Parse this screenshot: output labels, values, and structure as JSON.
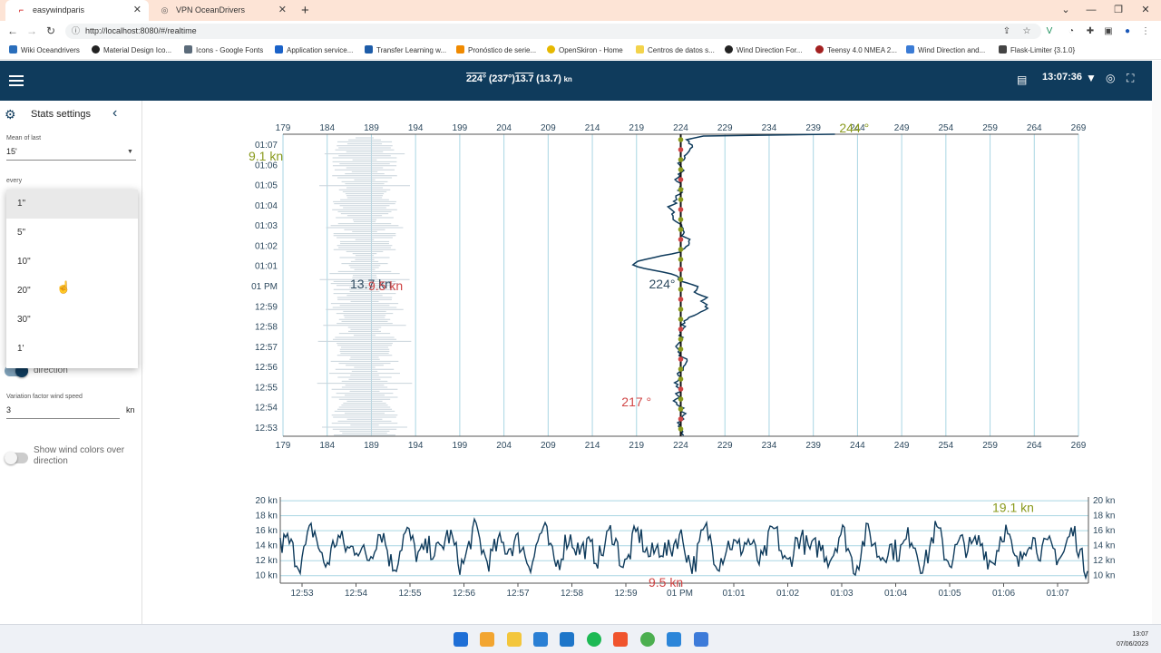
{
  "browser": {
    "tabs": [
      {
        "title": "easywindparis",
        "active": true
      },
      {
        "title": "VPN OceanDrivers",
        "active": false
      }
    ],
    "url": "http://localhost:8080/#/realtime",
    "bookmarks": [
      "Wiki Oceandrivers",
      "Material Design Ico...",
      "Icons - Google Fonts",
      "Application service...",
      "Transfer Learning w...",
      "Pronóstico de serie...",
      "OpenSkiron - Home",
      "Centros de datos s...",
      "Wind Direction For...",
      "Teensy 4.0 NMEA 2...",
      "Wind Direction and...",
      "Flask-Limiter {3.1.0}"
    ]
  },
  "appbar": {
    "dir_mean": "224°",
    "dir_current": "(237°)",
    "speed_mean": "13.7",
    "speed_current": "(13.7)",
    "speed_unit": "kn",
    "clock": "13:07:36"
  },
  "sidebar": {
    "title": "Stats settings",
    "mean_label": "Mean of last",
    "mean_value": "15'",
    "every_label": "every",
    "dropdown_options": [
      "1\"",
      "5\"",
      "10\"",
      "20\"",
      "30\"",
      "1'"
    ],
    "selected_option": "1\"",
    "toggle1_label": "direction",
    "variation_label": "Variation factor wind speed",
    "variation_value": "3",
    "variation_unit": "kn",
    "toggle2_label": "Show wind colors over direction"
  },
  "chart_data": [
    {
      "type": "line",
      "chart": "wind-direction",
      "x_ticks": [
        "179",
        "184",
        "189",
        "194",
        "199",
        "204",
        "209",
        "214",
        "219",
        "224",
        "229",
        "234",
        "239",
        "244",
        "249",
        "254",
        "259",
        "264",
        "269"
      ],
      "y_ticks": [
        "01:07",
        "01:06",
        "01:05",
        "01:04",
        "01:03",
        "01:02",
        "01:01",
        "01 PM",
        "12:59",
        "12:58",
        "12:57",
        "12:56",
        "12:55",
        "12:54",
        "12:53"
      ],
      "xlim": [
        179,
        269
      ],
      "mean_direction": 224,
      "annotations": [
        "244 °",
        "224°",
        "217 °",
        "13.7 kn",
        "9.5 kn",
        "9.1 kn"
      ]
    },
    {
      "type": "line",
      "chart": "wind-speed",
      "y_ticks": [
        "20 kn",
        "18 kn",
        "16 kn",
        "14 kn",
        "12 kn",
        "10 kn"
      ],
      "x_ticks": [
        "12:53",
        "12:54",
        "12:55",
        "12:56",
        "12:57",
        "12:58",
        "12:59",
        "01 PM",
        "01:01",
        "01:02",
        "01:03",
        "01:04",
        "01:05",
        "01:06",
        "01:07"
      ],
      "ylim": [
        9,
        20.5
      ],
      "annotations": [
        "19.1 kn",
        "9.5 kn"
      ]
    }
  ],
  "taskbar": {
    "time": "13:07",
    "date": "07/06/2023"
  }
}
